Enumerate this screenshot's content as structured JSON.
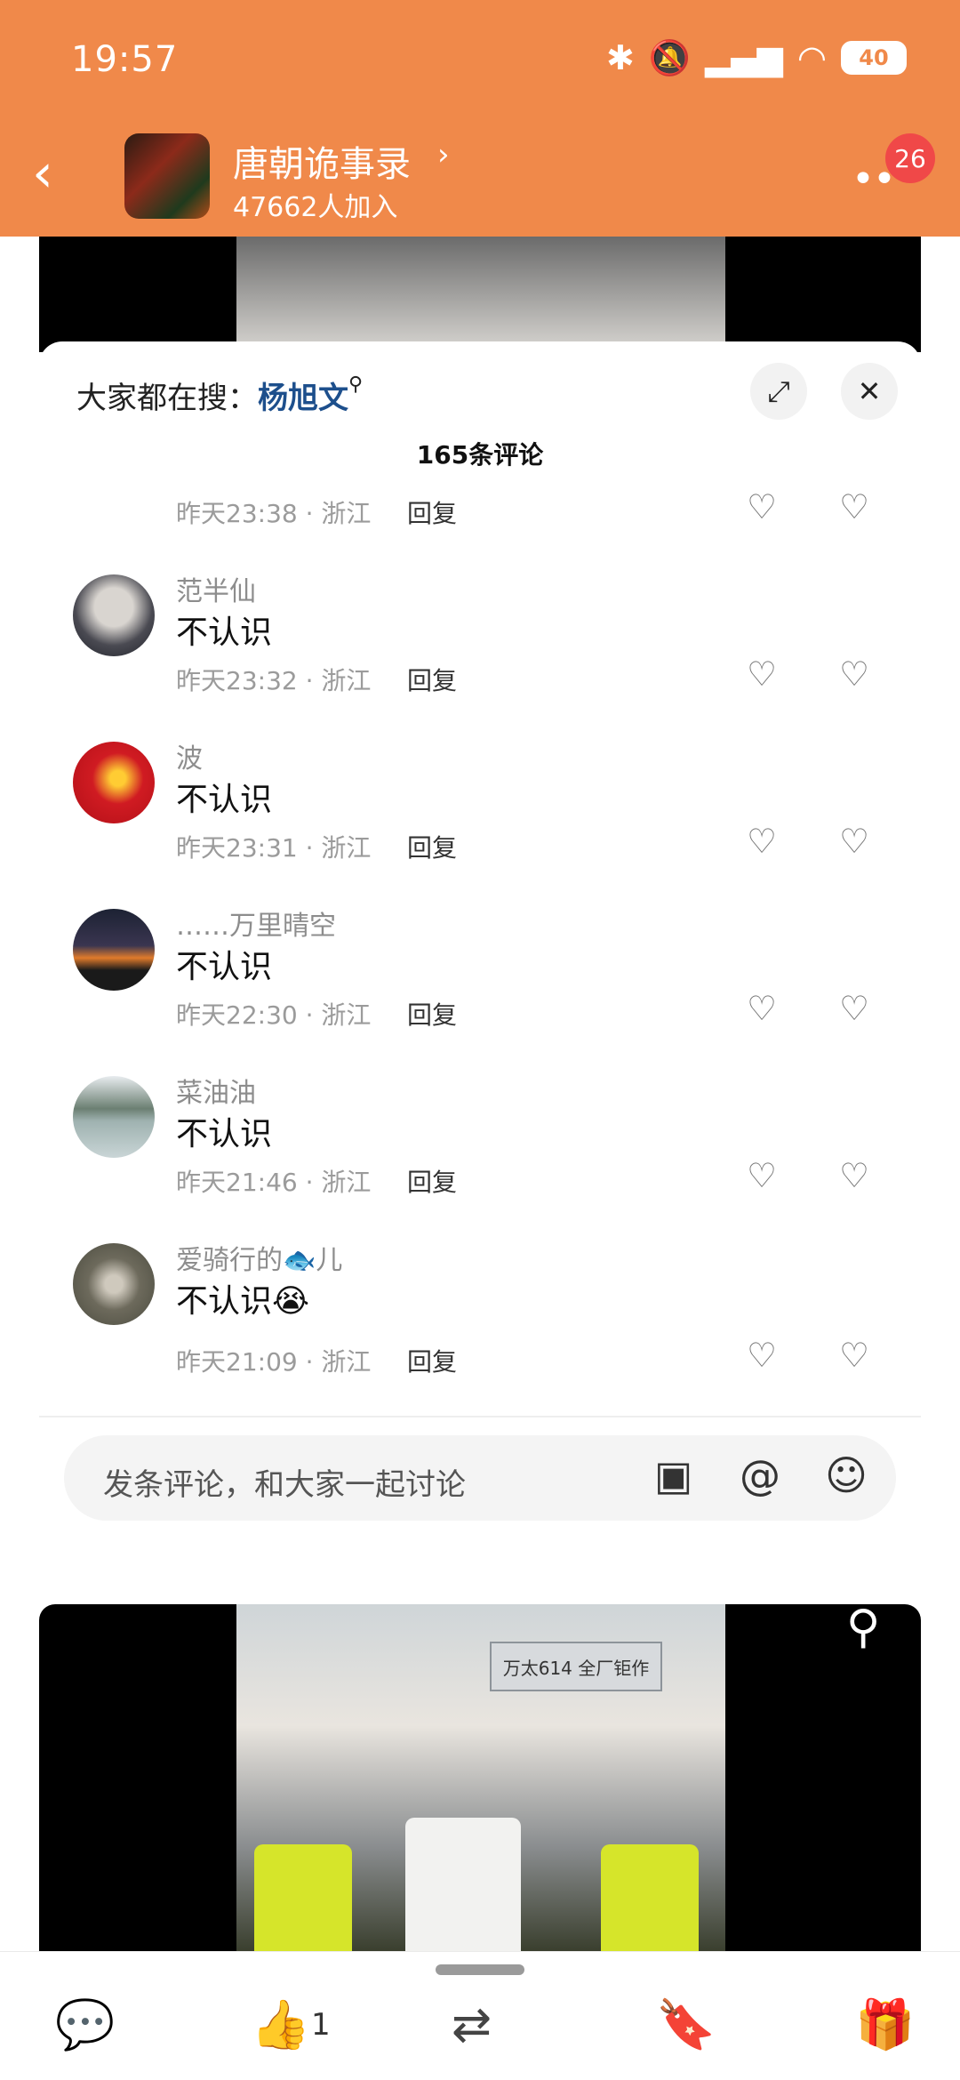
{
  "status_bar": {
    "time": "19:57",
    "icons": [
      "bluetooth-icon",
      "mute-icon",
      "5g-signal-icon",
      "wifi-icon"
    ],
    "battery": "40"
  },
  "header": {
    "group_name": "唐朝诡事录",
    "members": "47662人加入",
    "badge": "26",
    "more_label": "••"
  },
  "sheet": {
    "search_prefix": "大家都在搜：",
    "search_keyword": "杨旭文",
    "count": "165条评论",
    "first_meta": "昨天23:38 · 浙江",
    "reply_label": "回复",
    "comments": [
      {
        "name": "范半仙",
        "text": "不认识",
        "meta": "昨天23:32 · 浙江"
      },
      {
        "name": "波",
        "text": "不认识",
        "meta": "昨天23:31 · 浙江"
      },
      {
        "name": "……万里晴空",
        "text": "不认识",
        "meta": "昨天22:30 · 浙江"
      },
      {
        "name": "菜油油",
        "text": "不认识",
        "meta": "昨天21:46 · 浙江"
      },
      {
        "name": "爱骑行的🐟儿",
        "text": "不认识😭",
        "meta": "昨天21:09 · 浙江"
      }
    ],
    "input_placeholder": "发条评论，和大家一起讨论"
  },
  "video": {
    "banner_text": "万太614 全厂钜作"
  },
  "bottom_bar": {
    "like_count": "1"
  },
  "colors": {
    "header_bg": "#f0894a",
    "keyword": "#1d4f8c",
    "badge": "#f04848",
    "thumb": "#2da44e"
  }
}
